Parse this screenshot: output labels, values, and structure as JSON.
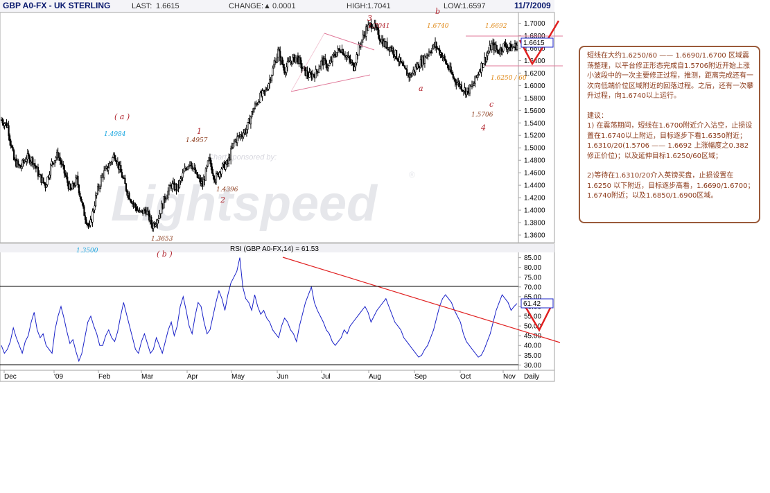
{
  "header": {
    "symbol": "GBP A0-FX - UK STERLING",
    "last_label": "LAST:",
    "last_value": "1.6615",
    "change_label": "CHANGE:",
    "change_arrow": "▲",
    "change_value": "0.0001",
    "high_label": "HIGH:",
    "high_value": "1.7041",
    "low_label": "LOW:",
    "low_value": "1.6597",
    "date": "11/7/2009"
  },
  "colors": {
    "navy": "#0a1a6e",
    "candle": "#000000",
    "rsi": "#1a22c8",
    "trend": "#e02020",
    "wave_label": "#b0202a",
    "cyan": "#19a6e0",
    "orange": "#e08a1a",
    "brown": "#8b3a1a"
  },
  "watermark": {
    "sponsor": "Chart sponsored by:",
    "brand": "Lightspeed",
    "reg": "®"
  },
  "price_last_box": "1.6615",
  "rsi_last_box": "61.42",
  "price_tick_labels": [
    "1.3600",
    "1.3800",
    "1.4000",
    "1.4200",
    "1.4400",
    "1.4600",
    "1.4800",
    "1.5000",
    "1.5200",
    "1.5400",
    "1.5600",
    "1.5800",
    "1.6000",
    "1.6200",
    "1.6400",
    "1.6600",
    "1.6800",
    "1.7000"
  ],
  "rsi_tick_labels": [
    "30.00",
    "35.00",
    "40.00",
    "45.00",
    "50.00",
    "55.00",
    "60.00",
    "65.00",
    "70.00",
    "75.00",
    "80.00",
    "85.00"
  ],
  "month_labels": [
    "Dec",
    "'09",
    "Feb",
    "Mar",
    "Apr",
    "May",
    "Jun",
    "Jul",
    "Aug",
    "Sep",
    "Oct",
    "Nov",
    "Daily"
  ],
  "annotations": {
    "a_paren": "( a )",
    "b_paren": "( b )",
    "w1": "1",
    "w2": "2",
    "w3": "3",
    "w4": "4",
    "wa": "a",
    "wb": "b",
    "wc": "c",
    "lvl_14984": "1.4984",
    "lvl_13500": "1.3500",
    "lvl_13653": "1.3653",
    "lvl_14957": "1.4957",
    "lvl_14396": "1.4396",
    "lvl_17041": "1.7041",
    "lvl_16740": "1.6740",
    "lvl_16692": "1.6692",
    "lvl_16250": "1.6250 / 60",
    "lvl_15706": "1.5706"
  },
  "rsi_title": "RSI (GBP A0-FX,14) = 61.53",
  "note": {
    "para1": "短线在大约1.6250/60 —— 1.6690/1.6700 区域震荡整理，以平台修正形态完成自1.5706附近开始上涨小波段中的一次主要修正过程，推测，距离完成还有一次向低端价位区域附近的回落过程。之后，还有一次攀升过程，向1.6740以上运行。",
    "title": "建议：",
    "item1": "1) 在震荡期间，短线在1.6700附近介入沽空，止损设置在1.6740以上附近，目标逐步下看1.6350附近；1.6310/20(1.5706 —— 1.6692 上涨幅度之0.382修正价位)；以及延伸目标1.6250/60区域；",
    "item2": "2)等待在1.6310/20介入英镑买盘，止损设置在1.6250 以下附近，目标逐步高看，1.6690/1.6700；1.6740附近；以及1.6850/1.6900区域。"
  },
  "chart_data": [
    {
      "type": "candlestick",
      "title": "GBP A0-FX - UK STERLING",
      "xlabel": "",
      "ylabel": "",
      "period": "Daily",
      "x_months": [
        "Dec",
        "'09",
        "Feb",
        "Mar",
        "Apr",
        "May",
        "Jun",
        "Jul",
        "Aug",
        "Sep",
        "Oct",
        "Nov"
      ],
      "ylim": [
        1.35,
        1.715
      ],
      "close_path": [
        [
          0,
          1.545
        ],
        [
          6,
          1.535
        ],
        [
          12,
          1.48
        ],
        [
          18,
          1.468
        ],
        [
          24,
          1.485
        ],
        [
          30,
          1.48
        ],
        [
          36,
          1.455
        ],
        [
          42,
          1.44
        ],
        [
          48,
          1.475
        ],
        [
          54,
          1.49
        ],
        [
          60,
          1.46
        ],
        [
          66,
          1.43
        ],
        [
          72,
          1.45
        ],
        [
          78,
          1.4
        ],
        [
          84,
          1.37
        ],
        [
          90,
          1.42
        ],
        [
          96,
          1.455
        ],
        [
          102,
          1.47
        ],
        [
          108,
          1.49
        ],
        [
          114,
          1.46
        ],
        [
          120,
          1.43
        ],
        [
          126,
          1.41
        ],
        [
          132,
          1.395
        ],
        [
          138,
          1.4
        ],
        [
          144,
          1.375
        ],
        [
          150,
          1.39
        ],
        [
          156,
          1.42
        ],
        [
          162,
          1.44
        ],
        [
          168,
          1.435
        ],
        [
          174,
          1.46
        ],
        [
          180,
          1.48
        ],
        [
          186,
          1.455
        ],
        [
          192,
          1.44
        ],
        [
          198,
          1.48
        ],
        [
          204,
          1.45
        ],
        [
          210,
          1.468
        ],
        [
          216,
          1.475
        ],
        [
          222,
          1.51
        ],
        [
          228,
          1.52
        ],
        [
          234,
          1.53
        ],
        [
          240,
          1.56
        ],
        [
          246,
          1.58
        ],
        [
          252,
          1.59
        ],
        [
          258,
          1.62
        ],
        [
          264,
          1.655
        ],
        [
          270,
          1.625
        ],
        [
          276,
          1.64
        ],
        [
          282,
          1.645
        ],
        [
          288,
          1.625
        ],
        [
          294,
          1.615
        ],
        [
          300,
          1.62
        ],
        [
          306,
          1.64
        ],
        [
          312,
          1.63
        ],
        [
          318,
          1.65
        ],
        [
          324,
          1.66
        ],
        [
          330,
          1.645
        ],
        [
          336,
          1.63
        ],
        [
          342,
          1.665
        ],
        [
          348,
          1.69
        ],
        [
          354,
          1.7
        ],
        [
          360,
          1.68
        ],
        [
          366,
          1.665
        ],
        [
          372,
          1.66
        ],
        [
          378,
          1.645
        ],
        [
          384,
          1.625
        ],
        [
          390,
          1.615
        ],
        [
          396,
          1.63
        ],
        [
          402,
          1.64
        ],
        [
          408,
          1.655
        ],
        [
          414,
          1.665
        ],
        [
          420,
          1.65
        ],
        [
          426,
          1.63
        ],
        [
          432,
          1.61
        ],
        [
          438,
          1.6
        ],
        [
          444,
          1.59
        ],
        [
          450,
          1.6
        ],
        [
          456,
          1.625
        ],
        [
          462,
          1.645
        ],
        [
          468,
          1.665
        ],
        [
          474,
          1.655
        ],
        [
          480,
          1.665
        ],
        [
          486,
          1.66
        ],
        [
          492,
          1.665
        ]
      ],
      "annotations": [
        "( a )",
        "( b )",
        "1",
        "2",
        "3",
        "4",
        "a",
        "b",
        "c",
        "1.4984",
        "1.3500",
        "1.3653",
        "1.4957",
        "1.4396",
        "1.7041",
        "1.6740",
        "1.6692",
        "1.6250 / 60",
        "1.5706"
      ],
      "last": 1.6615
    },
    {
      "type": "line",
      "title": "RSI (GBP A0-FX,14) = 61.53",
      "ylim": [
        28,
        87
      ],
      "series": [
        {
          "name": "RSI (GBP A0-FX,14)",
          "values": [
            40,
            36,
            38,
            42,
            49,
            44,
            40,
            36,
            42,
            45,
            52,
            57,
            48,
            44,
            46,
            40,
            38,
            36,
            48,
            55,
            60,
            54,
            47,
            41,
            43,
            37,
            32,
            36,
            44,
            52,
            55,
            50,
            46,
            40,
            40,
            45,
            48,
            44,
            42,
            47,
            55,
            62,
            56,
            50,
            44,
            38,
            36,
            42,
            46,
            41,
            36,
            38,
            44,
            40,
            36,
            42,
            48,
            52,
            45,
            50,
            60,
            65,
            58,
            50,
            46,
            55,
            62,
            60,
            52,
            46,
            48,
            55,
            62,
            68,
            64,
            58,
            66,
            72,
            75,
            78,
            85,
            70,
            64,
            62,
            58,
            66,
            60,
            56,
            58,
            54,
            52,
            48,
            46,
            44,
            50,
            54,
            52,
            48,
            46,
            42,
            50,
            56,
            62,
            66,
            70,
            62,
            58,
            55,
            52,
            48,
            46,
            42,
            40,
            42,
            44,
            48,
            46,
            50,
            52,
            54,
            56,
            58,
            60,
            57,
            52,
            55,
            58,
            60,
            62,
            64,
            60,
            56,
            52,
            50,
            48,
            44,
            42,
            40,
            38,
            36,
            34,
            35,
            38,
            40,
            44,
            48,
            54,
            60,
            64,
            66,
            64,
            62,
            58,
            55,
            52,
            46,
            42,
            40,
            38,
            36,
            34,
            35,
            38,
            42,
            46,
            52,
            58,
            62,
            66,
            64,
            62,
            58,
            60,
            61.5
          ]
        }
      ],
      "reference_lines": [
        30,
        70
      ],
      "last": 61.42
    }
  ]
}
